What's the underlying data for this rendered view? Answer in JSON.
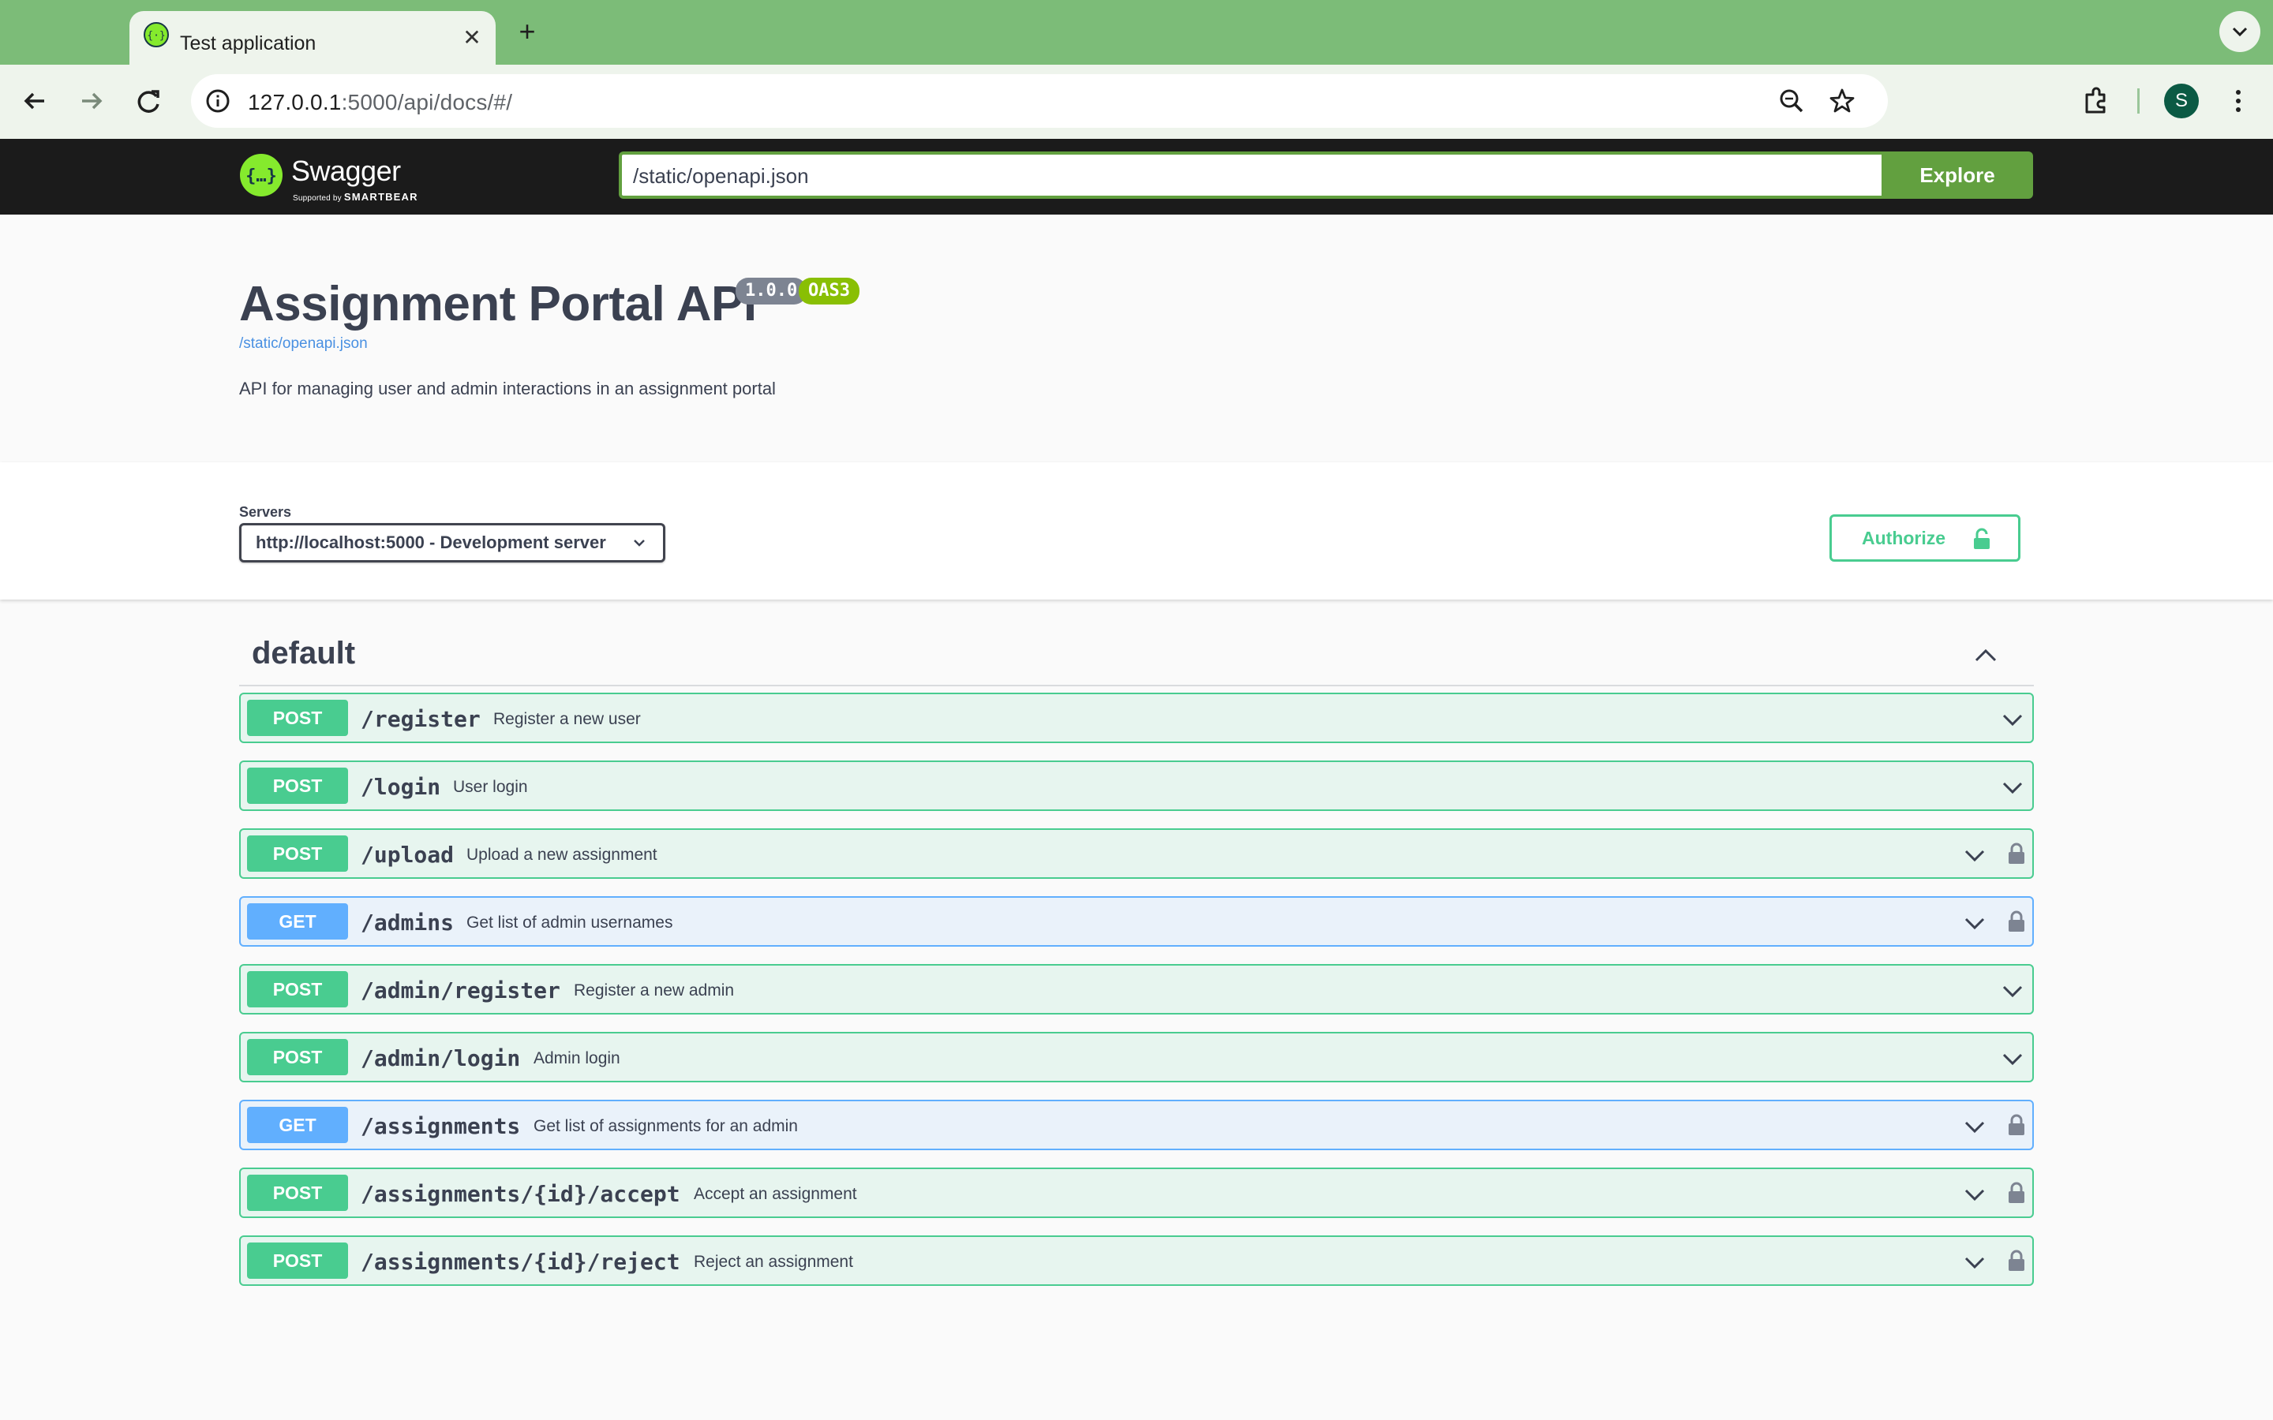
{
  "browser": {
    "tab_title": "Test application",
    "url_host": "127.0.0.1",
    "url_path": ":5000/api/docs/#/",
    "profile_initial": "S"
  },
  "swagger_topbar": {
    "logo_title": "Swagger",
    "logo_sub_prefix": "Supported by",
    "logo_sub_brand": "SMARTBEAR",
    "spec_url": "/static/openapi.json",
    "explore_label": "Explore"
  },
  "info": {
    "title": "Assignment Portal API",
    "version": "1.0.0",
    "oas": "OAS3",
    "spec_link": "/static/openapi.json",
    "description": "API for managing user and admin interactions in an assignment portal"
  },
  "servers": {
    "label": "Servers",
    "selected": "http://localhost:5000 - Development server"
  },
  "authorize_label": "Authorize",
  "tag": {
    "name": "default"
  },
  "operations": [
    {
      "method": "POST",
      "path": "/register",
      "summary": "Register a new user",
      "locked": false
    },
    {
      "method": "POST",
      "path": "/login",
      "summary": "User login",
      "locked": false
    },
    {
      "method": "POST",
      "path": "/upload",
      "summary": "Upload a new assignment",
      "locked": true
    },
    {
      "method": "GET",
      "path": "/admins",
      "summary": "Get list of admin usernames",
      "locked": true
    },
    {
      "method": "POST",
      "path": "/admin/register",
      "summary": "Register a new admin",
      "locked": false
    },
    {
      "method": "POST",
      "path": "/admin/login",
      "summary": "Admin login",
      "locked": false
    },
    {
      "method": "GET",
      "path": "/assignments",
      "summary": "Get list of assignments for an admin",
      "locked": true
    },
    {
      "method": "POST",
      "path": "/assignments/{id}/accept",
      "summary": "Accept an assignment",
      "locked": true
    },
    {
      "method": "POST",
      "path": "/assignments/{id}/reject",
      "summary": "Reject an assignment",
      "locked": true
    }
  ],
  "colors": {
    "post": "#49cc90",
    "get": "#61affe",
    "swagger_green": "#62a03f",
    "browser_frame": "#7cbc78"
  }
}
